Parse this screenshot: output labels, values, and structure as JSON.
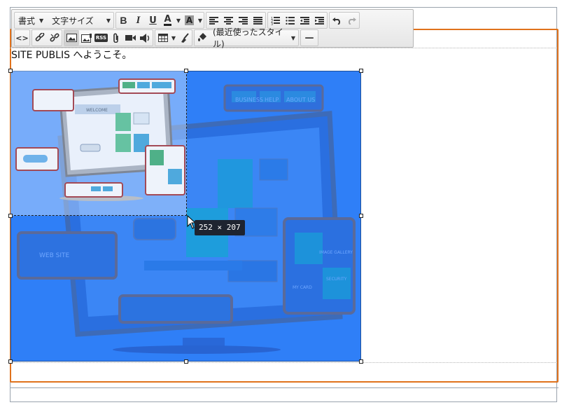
{
  "toolbar": {
    "format_label": "書式",
    "font_size_label": "文字サイズ",
    "recent_styles_label": "(最近使ったスタイル)",
    "buttons_row1": [
      "bold",
      "italic",
      "underline",
      "font-color",
      "background-color",
      "align-left",
      "align-center",
      "align-right",
      "align-justify",
      "numbered-list",
      "bulleted-list",
      "outdent",
      "indent",
      "undo",
      "redo"
    ],
    "buttons_row2": [
      "source",
      "link",
      "unlink",
      "image",
      "image-properties",
      "rss",
      "attachment",
      "video",
      "audio",
      "table",
      "clean",
      "paint-format",
      "horizontal-rule"
    ],
    "bold_glyph": "B",
    "italic_glyph": "I",
    "underline_glyph": "U",
    "font_color_glyph": "A",
    "bg_color_glyph": "A",
    "rss_glyph": "RSS",
    "source_glyph": "<>",
    "hr_glyph": "—"
  },
  "content": {
    "welcome_text": "SITE PUBLIS へようこそ。"
  },
  "image": {
    "tile_labels": [
      "BUSINESS",
      "HELP",
      "ABOUT US",
      "WEB SITE",
      "IMAGE GALLERY",
      "SECURITY",
      "MY CARD",
      "WELCOME"
    ],
    "selection_color": "#2f7ff7"
  },
  "resize_tooltip": {
    "text": "252 × 207"
  },
  "colors": {
    "editor_focus_border": "#e0721c",
    "tooltip_bg": "#1e2430"
  }
}
